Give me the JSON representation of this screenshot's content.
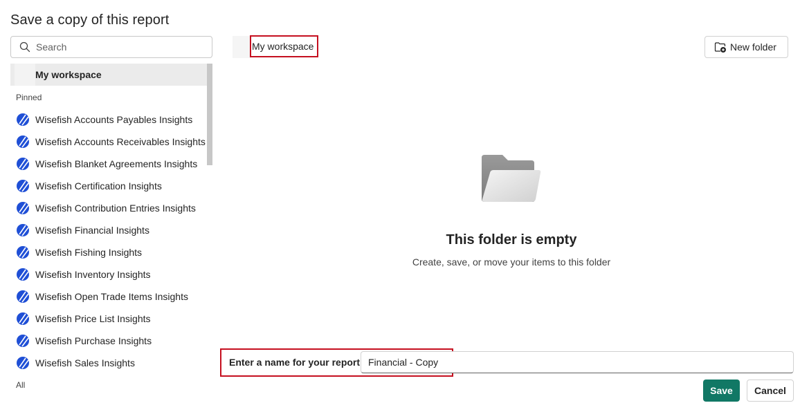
{
  "dialog": {
    "title": "Save a copy of this report"
  },
  "search": {
    "placeholder": "Search",
    "icon": "search-icon"
  },
  "nav": {
    "selected_workspace": "My workspace",
    "pinned_label": "Pinned",
    "all_label": "All",
    "items": [
      {
        "label": "Wisefish Accounts Payables Insights"
      },
      {
        "label": "Wisefish Accounts Receivables Insights"
      },
      {
        "label": "Wisefish Blanket Agreements Insights"
      },
      {
        "label": "Wisefish Certification Insights"
      },
      {
        "label": "Wisefish Contribution Entries Insights"
      },
      {
        "label": "Wisefish Financial Insights"
      },
      {
        "label": "Wisefish Fishing Insights"
      },
      {
        "label": "Wisefish Inventory Insights"
      },
      {
        "label": "Wisefish Open Trade Items Insights"
      },
      {
        "label": "Wisefish Price List Insights"
      },
      {
        "label": "Wisefish Purchase Insights"
      },
      {
        "label": "Wisefish Sales Insights"
      }
    ]
  },
  "main": {
    "breadcrumb": "My workspace",
    "new_folder_label": "New folder",
    "empty_title": "This folder is empty",
    "empty_subtitle": "Create, save, or move your items to this folder"
  },
  "form": {
    "name_label": "Enter a name for your report",
    "name_value": "Financial - Copy"
  },
  "buttons": {
    "save": "Save",
    "cancel": "Cancel"
  },
  "colors": {
    "accent": "#117865",
    "highlight_border": "#c50f1f",
    "report_icon": "#1f4fd6"
  }
}
